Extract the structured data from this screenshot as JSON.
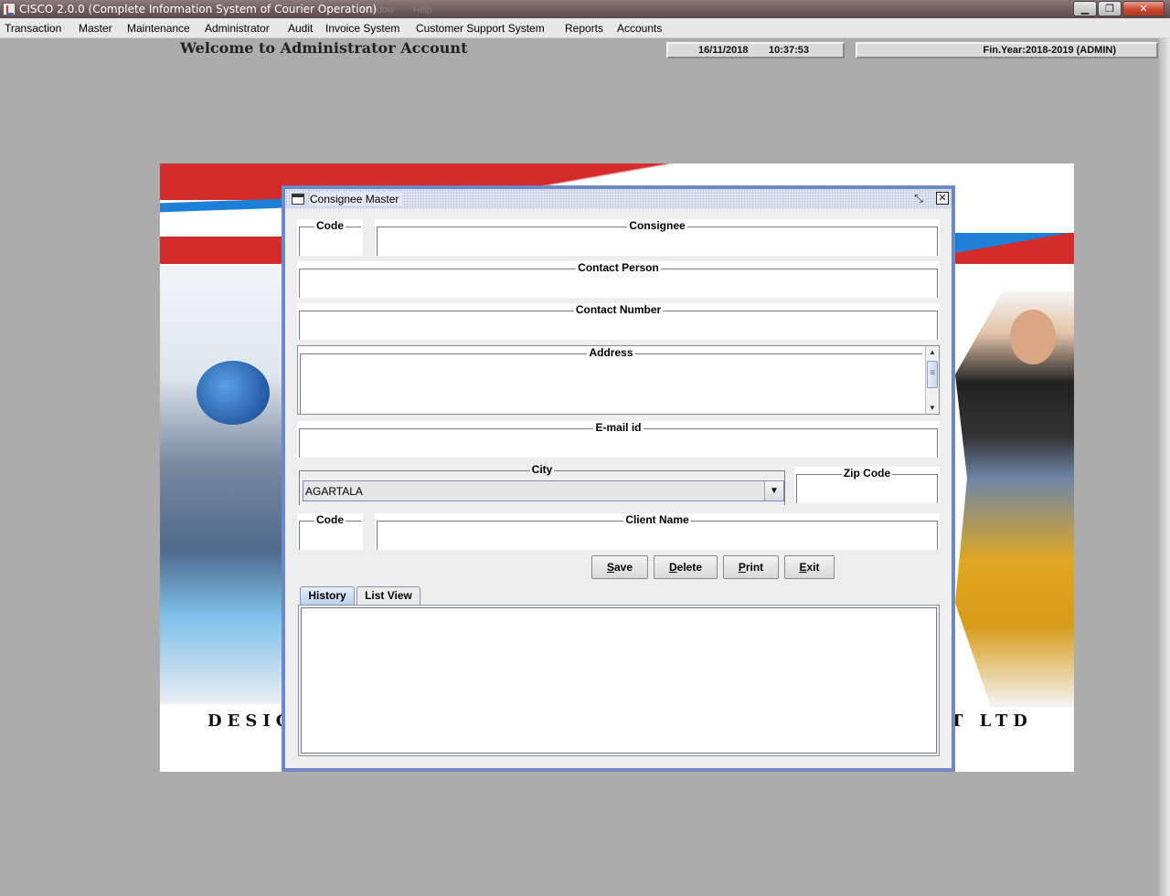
{
  "window": {
    "title": "CISCO 2.0.0 (Complete Information System of Courier Operation)",
    "ghost_menu": [
      "Window",
      "Help"
    ]
  },
  "menu": [
    {
      "label": "Transaction"
    },
    {
      "label": "Master"
    },
    {
      "label": "Maintenance"
    },
    {
      "label": "Administrator"
    },
    {
      "label": "Audit"
    },
    {
      "label": "Invoice System"
    },
    {
      "label": "Customer Support System"
    },
    {
      "label": "Reports"
    },
    {
      "label": "Accounts"
    }
  ],
  "header": {
    "welcome": "Welcome to Administrator Account",
    "date": "16/11/2018",
    "time": "10:37:53",
    "fin_year": "Fin.Year:2018-2019  (ADMIN)"
  },
  "poster": {
    "left_text": "DESIG",
    "right_text": "T LTD"
  },
  "dialog": {
    "title": "Consignee Master",
    "fields": {
      "code": {
        "label": "Code",
        "value": ""
      },
      "consignee": {
        "label": "Consignee",
        "value": ""
      },
      "contact_person": {
        "label": "Contact Person",
        "value": ""
      },
      "contact_number": {
        "label": "Contact Number",
        "value": ""
      },
      "address": {
        "label": "Address",
        "value": ""
      },
      "email": {
        "label": "E-mail id",
        "value": ""
      },
      "city": {
        "label": "City",
        "value": "AGARTALA"
      },
      "zip": {
        "label": "Zip Code",
        "value": ""
      },
      "client_code": {
        "label": "Code",
        "value": ""
      },
      "client_name": {
        "label": "Client Name",
        "value": ""
      }
    },
    "buttons": {
      "save": {
        "mnemonic": "S",
        "rest": "ave"
      },
      "delete": {
        "mnemonic": "D",
        "rest": "elete"
      },
      "print": {
        "mnemonic": "P",
        "rest": "rint"
      },
      "exit": {
        "mnemonic": "E",
        "rest": "xit"
      }
    },
    "tabs": [
      {
        "label": "History",
        "active": true
      },
      {
        "label": "List View",
        "active": false
      }
    ]
  },
  "colors": {
    "frame_border": "#6d89c7",
    "desktop": "#acacac",
    "poster_red": "#d42b2b",
    "poster_blue": "#1d7fd6"
  }
}
